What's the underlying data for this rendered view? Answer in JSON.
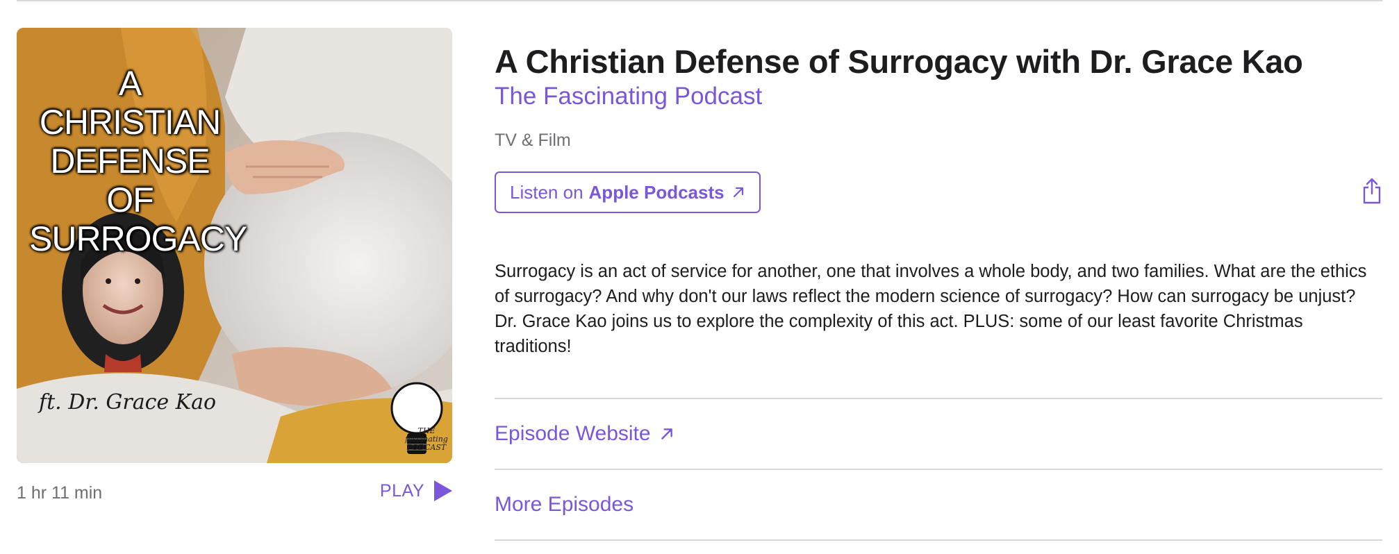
{
  "artwork": {
    "title_text": "A CHRISTIAN\nDEFENSE OF\nSURROGACY",
    "guest_text": "ft. Dr. Grace Kao",
    "logo_text": "THE fascinating PODCAST"
  },
  "player": {
    "duration": "1 hr 11 min",
    "play_label": "PLAY"
  },
  "episode": {
    "title": "A Christian Defense of Surrogacy with Dr. Grace Kao",
    "show_name": "The Fascinating Podcast",
    "category": "TV & Film",
    "description": "Surrogacy is an act of service for another, one that involves a whole body, and two families. What are the ethics of surrogacy? And why don't our laws reflect the modern science of surrogacy? How can surrogacy be unjust? Dr. Grace Kao joins us to explore the complexity of this act. PLUS: some of our least favorite Christmas traditions!"
  },
  "listen_button": {
    "prefix": "Listen on",
    "brand": "Apple Podcasts"
  },
  "links": {
    "episode_website": "Episode Website",
    "more_episodes": "More Episodes"
  },
  "icons": {
    "share": "share-icon",
    "external_arrow": "arrow-up-right-icon",
    "play": "play-icon"
  },
  "colors": {
    "accent": "#7a56db",
    "text_primary": "#1d1d1f",
    "text_secondary": "#6e6e73",
    "divider": "#d7d7d9"
  }
}
